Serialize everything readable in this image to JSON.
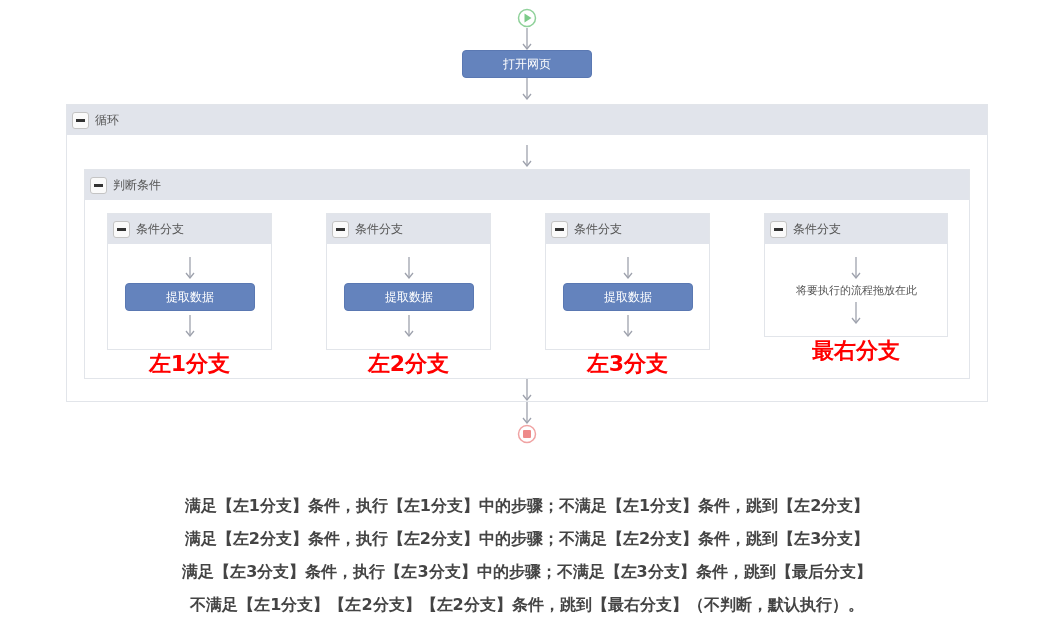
{
  "flow": {
    "start": {
      "kind": "start"
    },
    "steps": [
      {
        "kind": "action",
        "label": "打开网页"
      }
    ],
    "loop": {
      "title": "循环",
      "expanded": true,
      "condition": {
        "title": "判断条件",
        "expanded": true,
        "branches": [
          {
            "title": "条件分支",
            "expanded": true,
            "steps": [
              {
                "label": "提取数据"
              }
            ],
            "annotation": "左1分支"
          },
          {
            "title": "条件分支",
            "expanded": true,
            "steps": [
              {
                "label": "提取数据"
              }
            ],
            "annotation": "左2分支"
          },
          {
            "title": "条件分支",
            "expanded": true,
            "steps": [
              {
                "label": "提取数据"
              }
            ],
            "annotation": "左3分支"
          },
          {
            "title": "条件分支",
            "expanded": true,
            "drop_hint": "将要执行的流程拖放在此",
            "annotation": "最右分支"
          }
        ]
      }
    },
    "end": {
      "kind": "end"
    }
  },
  "notes": [
    "满足【左1分支】条件，执行【左1分支】中的步骤；不满足【左1分支】条件，跳到【左2分支】",
    "满足【左2分支】条件，执行【左2分支】中的步骤；不满足【左2分支】条件，跳到【左3分支】",
    "满足【左3分支】条件，执行【左3分支】中的步骤；不满足【左3分支】条件，跳到【最后分支】",
    "不满足【左1分支】【左2分支】【左2分支】条件，跳到【最右分支】（不判断，默认执行）。"
  ]
}
